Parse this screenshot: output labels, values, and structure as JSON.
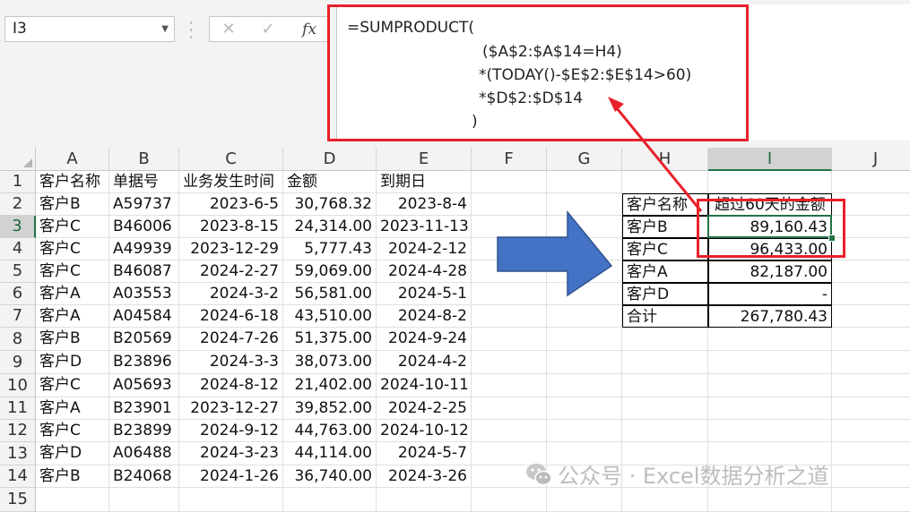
{
  "namebox": {
    "value": "I3"
  },
  "formula_bar": {
    "fx_label": "fx",
    "lines": [
      "=SUMPRODUCT(",
      "($A$2:$A$14=H4)",
      "*(TODAY()-$E$2:$E$14>60)",
      "*$D$2:$D$14",
      ")"
    ]
  },
  "columns": [
    "A",
    "B",
    "C",
    "D",
    "E",
    "F",
    "G",
    "H",
    "I",
    "J"
  ],
  "rows": [
    "1",
    "2",
    "3",
    "4",
    "5",
    "6",
    "7",
    "8",
    "9",
    "10",
    "11",
    "12",
    "13",
    "14",
    "15"
  ],
  "table": {
    "headers": [
      "客户名称",
      "单据号",
      "业务发生时间",
      "金额",
      "到期日"
    ],
    "rows": [
      [
        "客户B",
        "A59737",
        "2023-6-5",
        "30,768.32",
        "2023-8-4"
      ],
      [
        "客户C",
        "B46006",
        "2023-8-15",
        "24,314.00",
        "2023-11-13"
      ],
      [
        "客户C",
        "A49939",
        "2023-12-29",
        "5,777.43",
        "2024-2-12"
      ],
      [
        "客户C",
        "B46087",
        "2024-2-27",
        "59,069.00",
        "2024-4-28"
      ],
      [
        "客户A",
        "A03553",
        "2024-3-2",
        "56,581.00",
        "2024-5-1"
      ],
      [
        "客户A",
        "A04584",
        "2024-6-18",
        "43,510.00",
        "2024-8-2"
      ],
      [
        "客户B",
        "B20569",
        "2024-7-26",
        "51,375.00",
        "2024-9-24"
      ],
      [
        "客户D",
        "B23896",
        "2024-3-3",
        "38,073.00",
        "2024-4-2"
      ],
      [
        "客户C",
        "A05693",
        "2024-8-12",
        "21,402.00",
        "2024-10-11"
      ],
      [
        "客户A",
        "B23901",
        "2023-12-27",
        "39,852.00",
        "2024-2-25"
      ],
      [
        "客户C",
        "B23899",
        "2024-9-12",
        "44,763.00",
        "2024-10-12"
      ],
      [
        "客户D",
        "A06488",
        "2024-3-23",
        "44,114.00",
        "2024-5-7"
      ],
      [
        "客户B",
        "B24068",
        "2024-1-26",
        "36,740.00",
        "2024-3-26"
      ]
    ]
  },
  "summary": {
    "headers": [
      "客户名称",
      "超过60天的金额"
    ],
    "rows": [
      [
        "客户B",
        "89,160.43"
      ],
      [
        "客户C",
        "96,433.00"
      ],
      [
        "客户A",
        "82,187.00"
      ],
      [
        "客户D",
        "-"
      ],
      [
        "合计",
        "267,780.43"
      ]
    ]
  },
  "watermark": "公众号 · Excel数据分析之道",
  "colors": {
    "accent_green": "#217346",
    "highlight_red": "#e8202a",
    "arrow_blue": "#4472c4"
  }
}
